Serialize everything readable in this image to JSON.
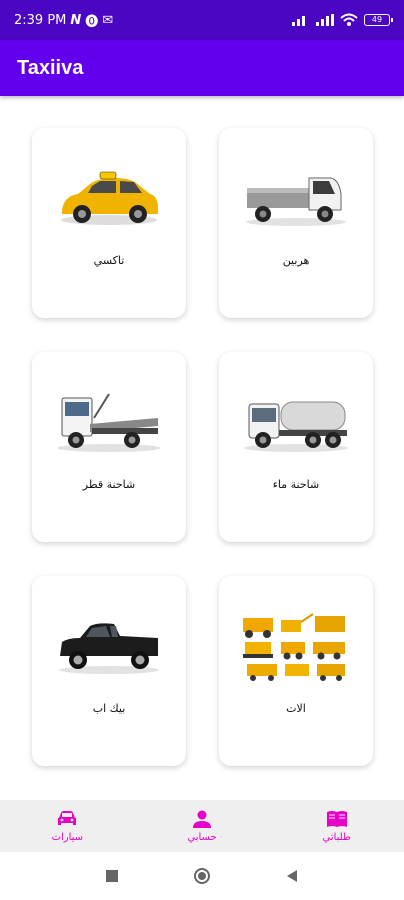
{
  "status_bar": {
    "time": "2:39 PM",
    "battery": "49"
  },
  "app_bar": {
    "title": "Taxiiva"
  },
  "categories": [
    {
      "label": "تاكسي",
      "icon": "taxi-icon"
    },
    {
      "label": "هربين",
      "icon": "pickup-truck-icon"
    },
    {
      "label": "شاحنة قطر",
      "icon": "tow-truck-icon"
    },
    {
      "label": "شاحنة ماء",
      "icon": "water-truck-icon"
    },
    {
      "label": "بيك اب",
      "icon": "pickup-car-icon"
    },
    {
      "label": "الات",
      "icon": "machinery-icon"
    }
  ],
  "bottom_nav": {
    "cars": "سيارات",
    "account": "حسابي",
    "orders": "طلباتي"
  },
  "colors": {
    "status_bar": "#4a06c2",
    "app_bar": "#6200ee",
    "nav_accent": "#e600c8"
  }
}
